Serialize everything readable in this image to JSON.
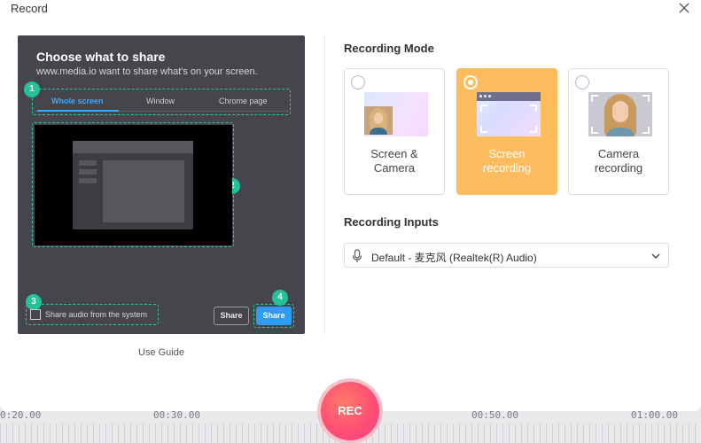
{
  "window": {
    "title": "Record"
  },
  "share_panel": {
    "heading": "Choose what to share",
    "subtitle": "www.media.io want to share what's on your screen.",
    "tabs": [
      {
        "label": "Whole screen",
        "active": true
      },
      {
        "label": "Window",
        "active": false
      },
      {
        "label": "Chrome page",
        "active": false
      }
    ],
    "audio_checkbox": {
      "label": "Share audio from the system",
      "checked": false
    },
    "buttons": {
      "share_ghost": "Share",
      "share_primary": "Share"
    },
    "badges": [
      "1",
      "2",
      "3",
      "4"
    ]
  },
  "use_guide": "Use Guide",
  "recording_mode": {
    "title": "Recording Mode",
    "options": [
      {
        "label": "Screen &\nCamera",
        "selected": false
      },
      {
        "label": "Screen\nrecording",
        "selected": true
      },
      {
        "label": "Camera\nrecording",
        "selected": false
      }
    ]
  },
  "recording_inputs": {
    "title": "Recording Inputs",
    "selected_value": "Default - 麦克风 (Realtek(R) Audio)"
  },
  "rec_button": "REC",
  "timeline": {
    "labels": [
      "0:20.00",
      "00:30.00",
      "00:50.00",
      "01:00.00"
    ]
  },
  "colors": {
    "accent_blue": "#2e9bf5",
    "selected_card": "#fdbc5e",
    "badge_green": "#25c29a",
    "rec_red": "#ff4f72"
  }
}
